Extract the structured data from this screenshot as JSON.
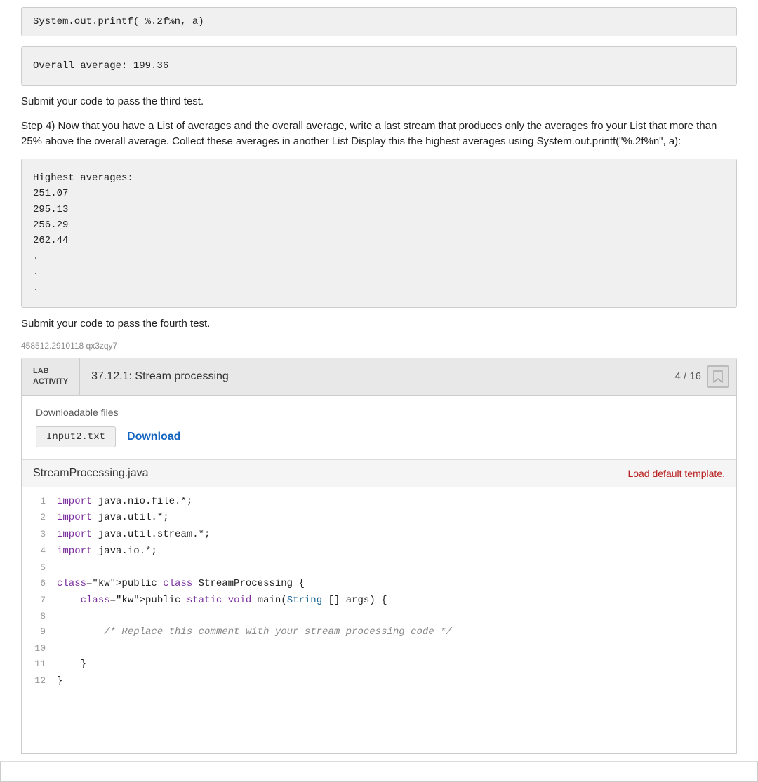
{
  "top_print_output": "System.out.printf( %.2f%n, a)",
  "overall_average": "Overall average: 199.36",
  "submit_third": "Submit your code to pass the third test.",
  "step4_text": "Step 4) Now that you have a List of averages and the overall average, write a last stream that produces only the averages fro your List that more than 25% above the overall average. Collect these averages in another List Display this the highest averages using System.out.printf(\"%.2f%n\", a):",
  "highest_averages_block": "Highest averages:\n251.07\n295.13\n256.29\n262.44\n.\n.\n.",
  "submit_fourth": "Submit your code to pass the fourth test.",
  "tracking_id": "458512.2910118 qx3zqy7",
  "lab_label_line1": "LAB",
  "lab_label_line2": "ACTIVITY",
  "lab_title": "37.12.1: Stream processing",
  "lab_progress": "4 / 16",
  "downloadable_files_label": "Downloadable files",
  "filename": "Input2.txt",
  "download_label": "Download",
  "code_filename": "StreamProcessing.java",
  "load_default_label": "Load default template.",
  "code_lines": [
    {
      "num": 1,
      "text": "import java.nio.file.*;",
      "type": "import"
    },
    {
      "num": 2,
      "text": "import java.util.*;",
      "type": "import"
    },
    {
      "num": 3,
      "text": "import java.util.stream.*;",
      "type": "import"
    },
    {
      "num": 4,
      "text": "import java.io.*;",
      "type": "import"
    },
    {
      "num": 5,
      "text": "",
      "type": "blank"
    },
    {
      "num": 6,
      "text": "public class StreamProcessing {",
      "type": "code"
    },
    {
      "num": 7,
      "text": "    public static void main(String [] args) {",
      "type": "code"
    },
    {
      "num": 8,
      "text": "",
      "type": "blank"
    },
    {
      "num": 9,
      "text": "        /* Replace this comment with your stream processing code */",
      "type": "comment"
    },
    {
      "num": 10,
      "text": "",
      "type": "blank"
    },
    {
      "num": 11,
      "text": "    }",
      "type": "code"
    },
    {
      "num": 12,
      "text": "}",
      "type": "code"
    }
  ]
}
